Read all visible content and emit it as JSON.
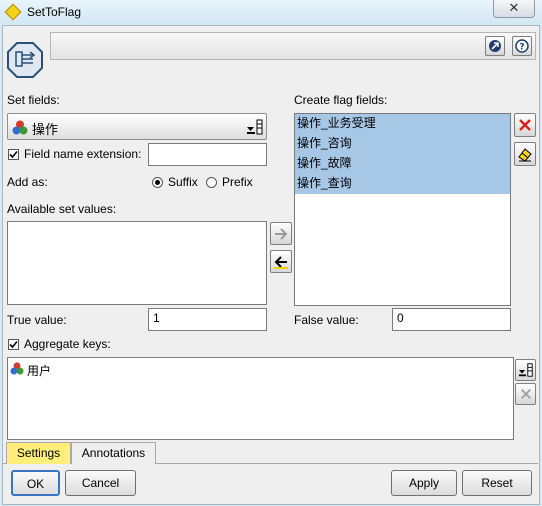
{
  "window": {
    "title": "SetToFlag",
    "close_glyph": "✕"
  },
  "header": {
    "node_icon": "settoflag-node-icon",
    "expand_icon": "expand-arrow-icon",
    "help_icon": "help-question-icon"
  },
  "set_fields": {
    "label": "Set fields:",
    "value": "操作"
  },
  "field_name_extension": {
    "label": "Field name extension:",
    "checked": true,
    "value": ""
  },
  "add_as": {
    "label": "Add as:",
    "suffix": "Suffix",
    "prefix": "Prefix",
    "selected": "Suffix"
  },
  "available_set_values": {
    "label": "Available set values:",
    "items": []
  },
  "create_flag_fields": {
    "label": "Create flag fields:",
    "items": [
      "操作_业务受理",
      "操作_咨询",
      "操作_故障",
      "操作_查询"
    ]
  },
  "true_value": {
    "label": "True value:",
    "value": "1"
  },
  "false_value": {
    "label": "False value:",
    "value": "0"
  },
  "aggregate_keys": {
    "label": "Aggregate keys:",
    "checked": true,
    "items": [
      "用户"
    ]
  },
  "tabs": [
    {
      "label": "Settings",
      "active": true
    },
    {
      "label": "Annotations",
      "active": false
    }
  ],
  "buttons": {
    "ok": "OK",
    "cancel": "Cancel",
    "apply": "Apply",
    "reset": "Reset"
  },
  "colors": {
    "selection": "#a7c7e7",
    "active_tab": "#ffef7a",
    "delete_red": "#d9201c"
  }
}
